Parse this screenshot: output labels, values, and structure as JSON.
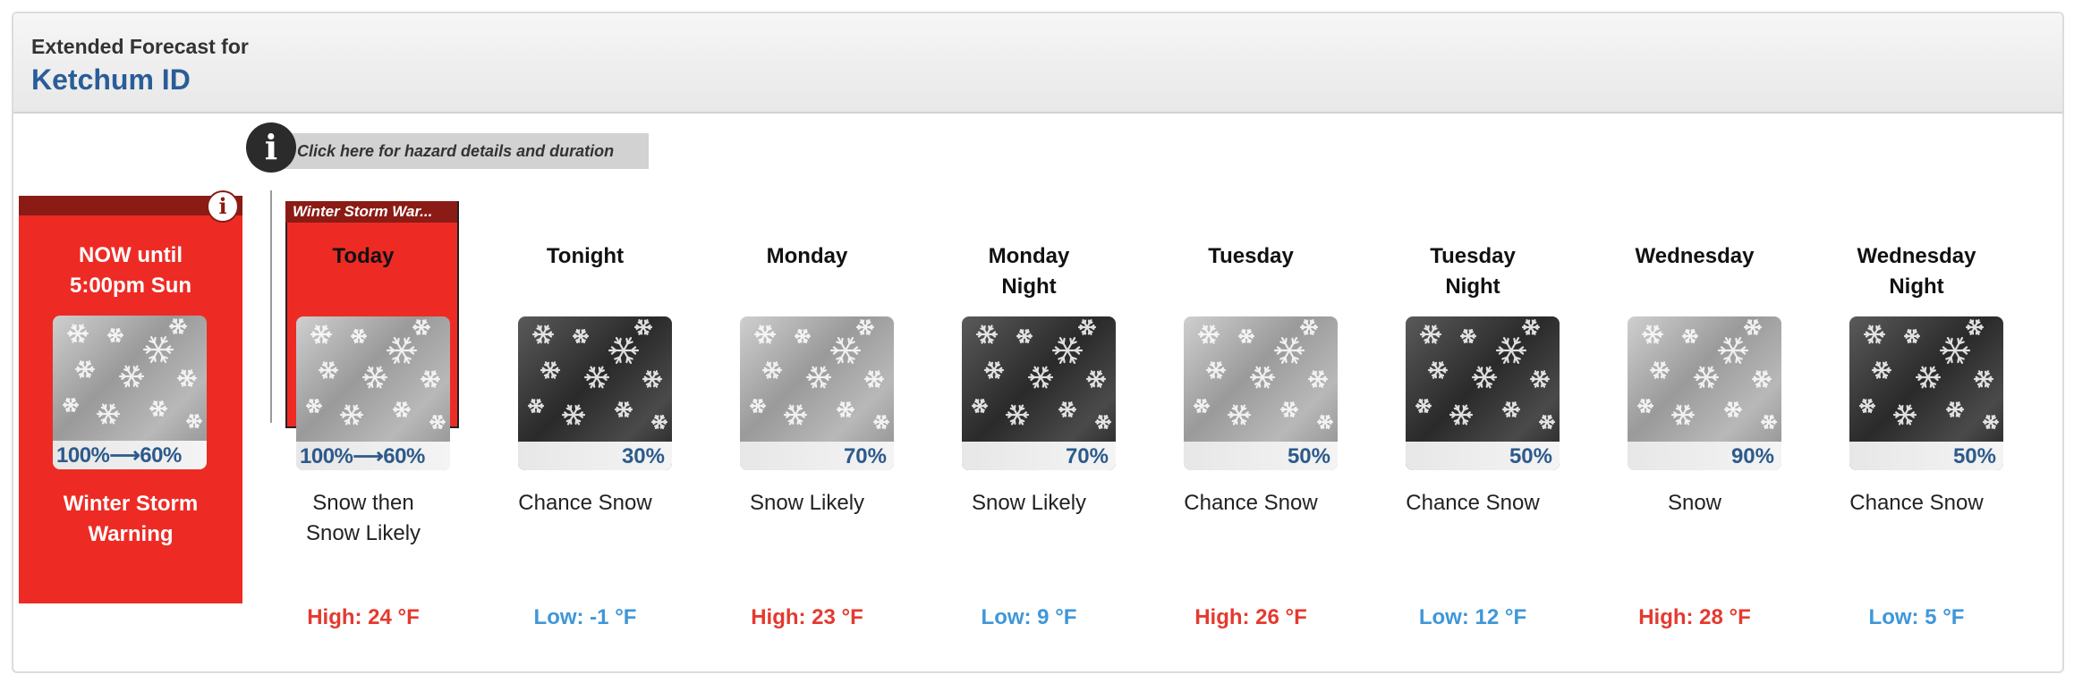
{
  "header": {
    "title": "Extended Forecast for",
    "location": "Ketchum ID"
  },
  "hazard_link": {
    "label": "Click here for hazard details and duration",
    "icon": "info-icon"
  },
  "now": {
    "title_line1": "NOW until",
    "title_line2": "5:00pm Sun",
    "pop": "100%⟶60%",
    "warning_line1": "Winter Storm",
    "warning_line2": "Warning"
  },
  "today_tag": "Winter Storm War...",
  "periods": [
    {
      "name_line1": "Today",
      "name_line2": "",
      "pop": "100%⟶60%",
      "desc_line1": "Snow then",
      "desc_line2": "Snow Likely",
      "temp": "High: 24 °F",
      "temp_type": "high",
      "icon_tone": "light"
    },
    {
      "name_line1": "Tonight",
      "name_line2": "",
      "pop": "30%",
      "desc_line1": "Chance Snow",
      "desc_line2": "",
      "temp": "Low: -1 °F",
      "temp_type": "low",
      "icon_tone": "dark"
    },
    {
      "name_line1": "Monday",
      "name_line2": "",
      "pop": "70%",
      "desc_line1": "Snow Likely",
      "desc_line2": "",
      "temp": "High: 23 °F",
      "temp_type": "high",
      "icon_tone": "light"
    },
    {
      "name_line1": "Monday",
      "name_line2": "Night",
      "pop": "70%",
      "desc_line1": "Snow Likely",
      "desc_line2": "",
      "temp": "Low: 9 °F",
      "temp_type": "low",
      "icon_tone": "dark"
    },
    {
      "name_line1": "Tuesday",
      "name_line2": "",
      "pop": "50%",
      "desc_line1": "Chance Snow",
      "desc_line2": "",
      "temp": "High: 26 °F",
      "temp_type": "high",
      "icon_tone": "light"
    },
    {
      "name_line1": "Tuesday",
      "name_line2": "Night",
      "pop": "50%",
      "desc_line1": "Chance Snow",
      "desc_line2": "",
      "temp": "Low: 12 °F",
      "temp_type": "low",
      "icon_tone": "dark"
    },
    {
      "name_line1": "Wednesday",
      "name_line2": "",
      "pop": "90%",
      "desc_line1": "Snow",
      "desc_line2": "",
      "temp": "High: 28 °F",
      "temp_type": "high",
      "icon_tone": "light"
    },
    {
      "name_line1": "Wednesday",
      "name_line2": "Night",
      "pop": "50%",
      "desc_line1": "Chance Snow",
      "desc_line2": "",
      "temp": "Low: 5 °F",
      "temp_type": "low",
      "icon_tone": "dark"
    }
  ],
  "colors": {
    "warning_red": "#ed2b24",
    "warning_dark": "#8b1b15",
    "location_blue": "#2a5d98",
    "high_temp": "#e5392f",
    "low_temp": "#3f97d8"
  }
}
